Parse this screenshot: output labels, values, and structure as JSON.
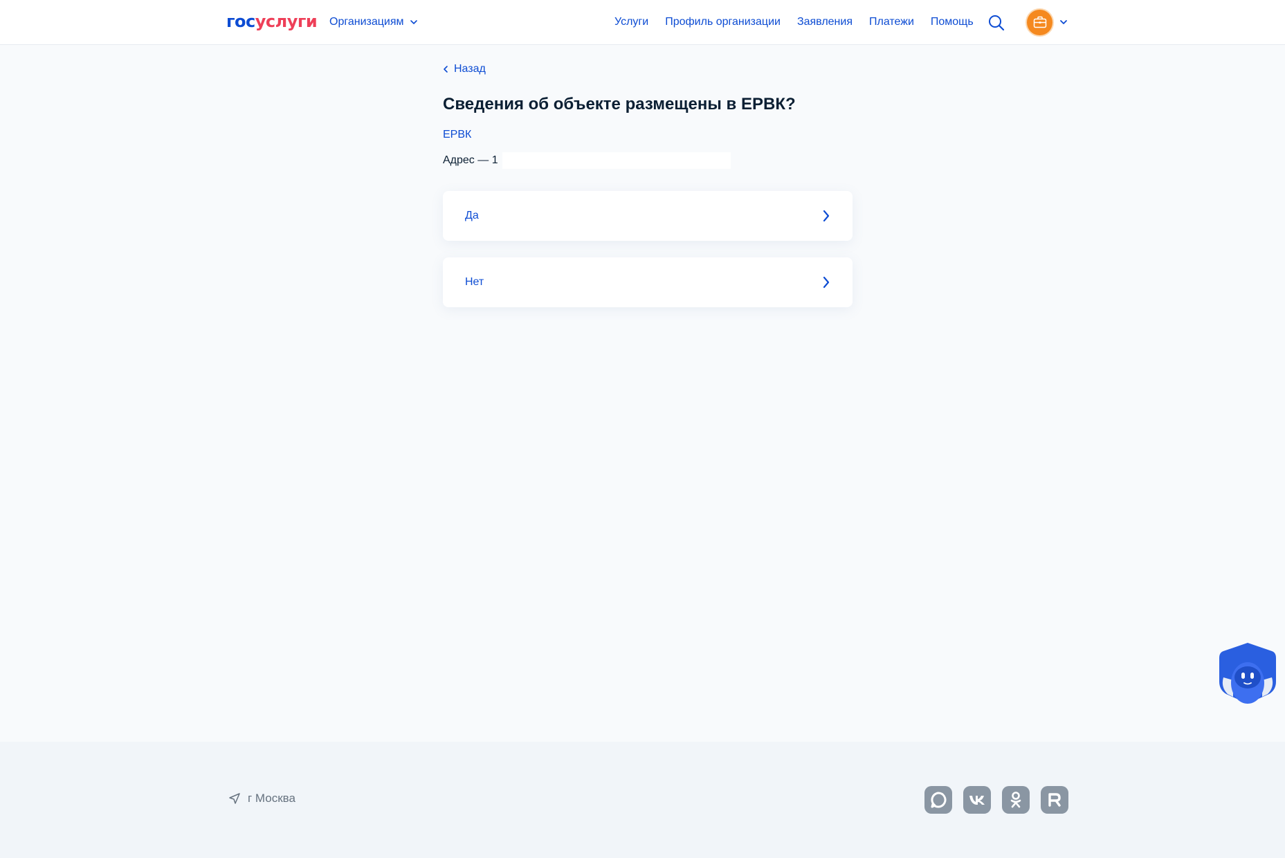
{
  "header": {
    "logo_part1": "гос",
    "logo_part2": "услуги",
    "org_switch_label": "Организациям",
    "nav": {
      "services": "Услуги",
      "org_profile": "Профиль организации",
      "applications": "Заявления",
      "payments": "Платежи",
      "help": "Помощь"
    }
  },
  "main": {
    "back_label": "Назад",
    "title": "Сведения об объекте размещены в ЕРВК?",
    "subtitle": "ЕРВК",
    "address_label": "Адрес — 1",
    "options": [
      {
        "label": "Да"
      },
      {
        "label": "Нет"
      }
    ]
  },
  "footer": {
    "city": "г Москва"
  },
  "icons": {
    "search": "search-icon",
    "avatar": "briefcase-icon",
    "chevron": "chevron-right-icon",
    "location": "location-arrow-icon",
    "socials": [
      "max-messenger-icon",
      "vk-icon",
      "odnoklassniki-icon",
      "rutube-icon"
    ]
  },
  "colors": {
    "primary": "#0d4cd3",
    "logo_red": "#ee3f58",
    "avatar": "#f5891f",
    "text": "#0b1f33",
    "page_bg": "#f8fafc",
    "footer_bg": "#f1f5f9",
    "social_bg": "#8a96a3"
  }
}
